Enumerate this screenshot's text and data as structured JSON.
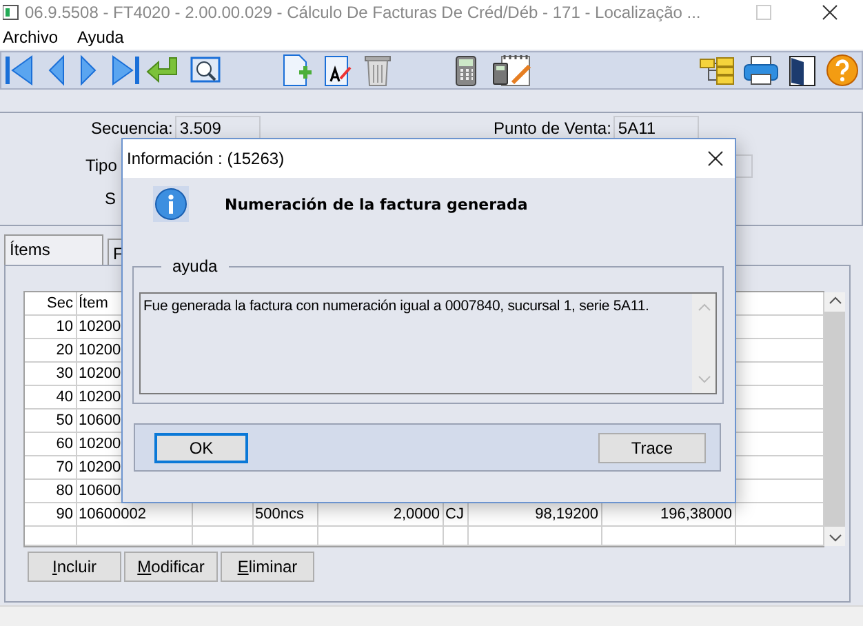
{
  "window": {
    "title": "06.9.5508 - FT4020 - 2.00.00.029 - Cálculo De Facturas De Créd/Déb - 171 - Localização ..."
  },
  "menu": [
    {
      "label": "Archivo"
    },
    {
      "label": "Ayuda"
    }
  ],
  "header": {
    "fields": [
      {
        "label": "Secuencia:",
        "value": "3.509"
      },
      {
        "label": "Tipo"
      },
      {
        "label": "S"
      },
      {
        "label": "Punto de Venta:",
        "value": "5A11"
      }
    ]
  },
  "tabs": [
    {
      "label": "Ítems",
      "selected": true
    },
    {
      "label": "F",
      "selected": false
    }
  ],
  "table": {
    "columns": [
      {
        "label": "Sec"
      },
      {
        "label": "Ítem"
      }
    ],
    "rows": [
      {
        "sec": "10",
        "item": "10200"
      },
      {
        "sec": "20",
        "item": "10200"
      },
      {
        "sec": "30",
        "item": "10200"
      },
      {
        "sec": "40",
        "item": "10200"
      },
      {
        "sec": "50",
        "item": "10600"
      },
      {
        "sec": "60",
        "item": "10200"
      },
      {
        "sec": "70",
        "item": "10200"
      },
      {
        "sec": "80",
        "item": "10600"
      },
      {
        "sec": "90",
        "item": "10600002",
        "column_4": "500ncs",
        "column_5": "2,0000",
        "unit": "CJ",
        "column_7": "98,19200",
        "column_8": "196,38000"
      }
    ]
  },
  "buttons": [
    {
      "label": "Incluir"
    },
    {
      "label": "Modificar"
    },
    {
      "label": "Eliminar"
    }
  ],
  "dialog": {
    "title": "Información : (15263)",
    "message": "Numeración de la factura generada",
    "group": "ayuda",
    "detail": "Fue generada la factura con numeración igual a 0007840, sucursal 1, serie 5A11.",
    "buttons": [
      {
        "label": "OK",
        "focused": true
      },
      {
        "label": "Trace",
        "focused": false
      }
    ]
  }
}
